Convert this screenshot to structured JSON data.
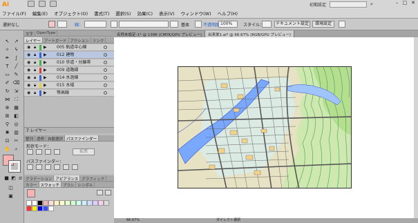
{
  "app": {
    "logo": "Ai",
    "workspace_label": "初期設定",
    "window_buttons": [
      "–",
      "□",
      "✕"
    ]
  },
  "menu": [
    "ファイル(F)",
    "編集(E)",
    "オブジェクト(O)",
    "書式(T)",
    "選択(S)",
    "効果(C)",
    "表示(V)",
    "ウィンドウ(W)",
    "ヘルプ(H)"
  ],
  "control": {
    "selection": "選択なし",
    "stroke_label": "線：",
    "stroke_style": "基本",
    "opacity_label": "不透明度",
    "opacity_value": "100%",
    "style_label": "スタイル：",
    "doc_settings": "ドキュメント設定",
    "preferences": "環境設定"
  },
  "layers_panel": {
    "tabs": [
      "レイヤー",
      "アートボード",
      "アクション",
      "リンク"
    ],
    "top_tabs": [
      "文字",
      "OpenType"
    ],
    "layers": [
      {
        "name": "005 軌道中心線",
        "color": "#3fb845"
      },
      {
        "name": "012 建物",
        "color": "#3b62d6",
        "selected": true
      },
      {
        "name": "010 歩道・分離帯",
        "color": "#3fb845"
      },
      {
        "name": "009 道路縁",
        "color": "#d84040"
      },
      {
        "name": "014 水涯線",
        "color": "#3b62d6"
      },
      {
        "name": "015 水域",
        "color": "#e0d040"
      },
      {
        "name": "等高線",
        "color": "#3b62d6"
      }
    ],
    "footer": "7 レイヤー"
  },
  "pathfinder": {
    "tabs": [
      "整列",
      "透明",
      "自動選択",
      "パスファインダー"
    ],
    "shape_mode": "形状モード：",
    "expand": "拡張",
    "pathfinder_label": "パスファインダー："
  },
  "swatches": {
    "tabs": [
      "グラデーション",
      "アピアランス",
      "グラフィック"
    ],
    "tabs2": [
      "カラー",
      "スウォッチ",
      "ブラシ",
      "シンボル"
    ]
  },
  "documents": {
    "tabs": [
      {
        "label": "名称未設定-1* @ 1396 (CMYK/GPU プレビュー)",
        "active": false
      },
      {
        "label": "出来栄1.ai* @ 66.67% (RGB/GPU プレビュー)",
        "active": true
      }
    ],
    "zoom": "66.67%",
    "status_tool": "ダイレクト選択"
  }
}
